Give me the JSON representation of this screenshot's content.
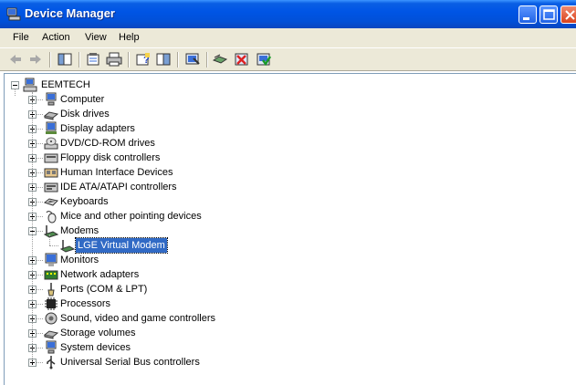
{
  "window": {
    "title": "Device Manager"
  },
  "menubar": {
    "items": [
      "File",
      "Action",
      "View",
      "Help"
    ]
  },
  "toolbar": {
    "buttons": [
      "back-icon",
      "forward-icon",
      "show-hide-tree-icon",
      "properties-icon",
      "print-icon",
      "help-icon",
      "show-hide-action-pane-icon",
      "scan-hardware-icon",
      "update-driver-icon",
      "uninstall-icon",
      "enable-device-icon"
    ]
  },
  "tree": {
    "root": "EEMTECH",
    "categories": [
      {
        "label": "Computer",
        "icon": "computer-icon"
      },
      {
        "label": "Disk drives",
        "icon": "disk-drive-icon"
      },
      {
        "label": "Display adapters",
        "icon": "display-adapter-icon"
      },
      {
        "label": "DVD/CD-ROM drives",
        "icon": "cdrom-icon"
      },
      {
        "label": "Floppy disk controllers",
        "icon": "floppy-controller-icon"
      },
      {
        "label": "Human Interface Devices",
        "icon": "hid-icon"
      },
      {
        "label": "IDE ATA/ATAPI controllers",
        "icon": "ide-controller-icon"
      },
      {
        "label": "Keyboards",
        "icon": "keyboard-icon"
      },
      {
        "label": "Mice and other pointing devices",
        "icon": "mouse-icon"
      },
      {
        "label": "Modems",
        "icon": "modem-icon",
        "expanded": true,
        "children": [
          {
            "label": "LGE Virtual Modem",
            "icon": "modem-icon",
            "selected": true
          }
        ]
      },
      {
        "label": "Monitors",
        "icon": "monitor-icon"
      },
      {
        "label": "Network adapters",
        "icon": "network-adapter-icon"
      },
      {
        "label": "Ports (COM & LPT)",
        "icon": "port-icon"
      },
      {
        "label": "Processors",
        "icon": "processor-icon"
      },
      {
        "label": "Sound, video and game controllers",
        "icon": "sound-icon"
      },
      {
        "label": "Storage volumes",
        "icon": "storage-volume-icon"
      },
      {
        "label": "System devices",
        "icon": "system-device-icon"
      },
      {
        "label": "Universal Serial Bus controllers",
        "icon": "usb-icon"
      }
    ]
  },
  "colors": {
    "selection": "#316ac5",
    "titlebar": "#0055e5",
    "chrome": "#ece9d8"
  }
}
